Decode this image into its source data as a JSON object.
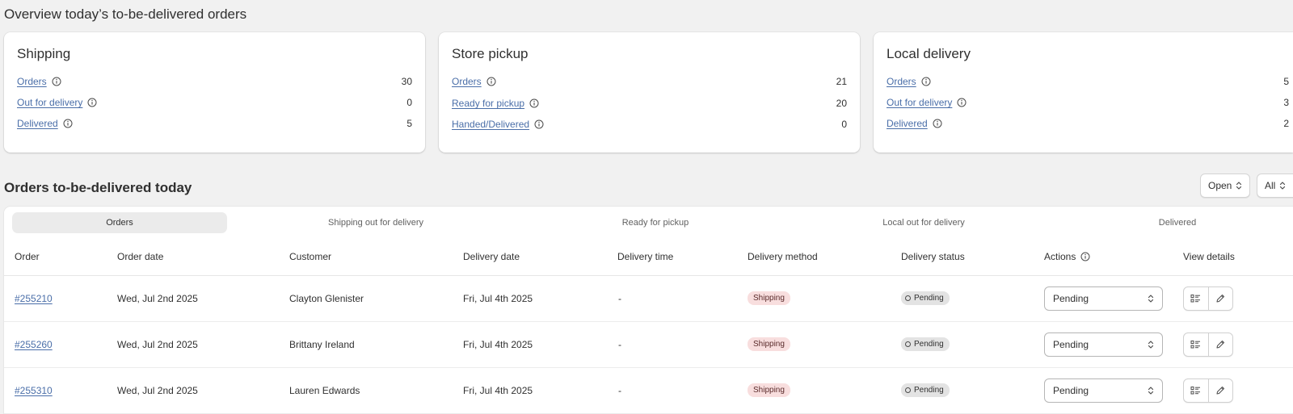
{
  "page": {
    "title": "Overview today’s to-be-delivered orders"
  },
  "cards": [
    {
      "title": "Shipping",
      "stats": [
        {
          "label": "Orders",
          "value": "30"
        },
        {
          "label": "Out for delivery",
          "value": "0"
        },
        {
          "label": "Delivered",
          "value": "5"
        }
      ]
    },
    {
      "title": "Store pickup",
      "stats": [
        {
          "label": "Orders",
          "value": "21"
        },
        {
          "label": "Ready for pickup",
          "value": "20"
        },
        {
          "label": "Handed/Delivered",
          "value": "0"
        }
      ]
    },
    {
      "title": "Local delivery",
      "stats": [
        {
          "label": "Orders",
          "value": "5"
        },
        {
          "label": "Out for delivery",
          "value": "3"
        },
        {
          "label": "Delivered",
          "value": "2"
        }
      ]
    }
  ],
  "orders_section": {
    "title": "Orders to-be-delivered today",
    "filters": {
      "status": "Open",
      "scope": "All"
    },
    "tabs": [
      "Orders",
      "Shipping out for delivery",
      "Ready for pickup",
      "Local out for delivery",
      "Delivered"
    ],
    "columns": [
      "Order",
      "Order date",
      "Customer",
      "Delivery date",
      "Delivery time",
      "Delivery method",
      "Delivery status",
      "Actions",
      "View details"
    ],
    "rows": [
      {
        "order": "#255210",
        "order_date": "Wed, Jul 2nd 2025",
        "customer": "Clayton Glenister",
        "delivery_date": "Fri, Jul 4th 2025",
        "delivery_time": "-",
        "method": "Shipping",
        "status": "Pending",
        "action": "Pending"
      },
      {
        "order": "#255260",
        "order_date": "Wed, Jul 2nd 2025",
        "customer": "Brittany Ireland",
        "delivery_date": "Fri, Jul 4th 2025",
        "delivery_time": "-",
        "method": "Shipping",
        "status": "Pending",
        "action": "Pending"
      },
      {
        "order": "#255310",
        "order_date": "Wed, Jul 2nd 2025",
        "customer": "Lauren Edwards",
        "delivery_date": "Fri, Jul 4th 2025",
        "delivery_time": "-",
        "method": "Shipping",
        "status": "Pending",
        "action": "Pending"
      }
    ]
  },
  "icons": {
    "info": "info-icon",
    "select_arrows": "chevron-up-down-icon",
    "view": "list-details-icon",
    "edit": "pencil-icon"
  },
  "colors": {
    "link": "#4a6ea8",
    "shipping_badge": "#f8dede",
    "status_badge": "#e3e3e3"
  }
}
